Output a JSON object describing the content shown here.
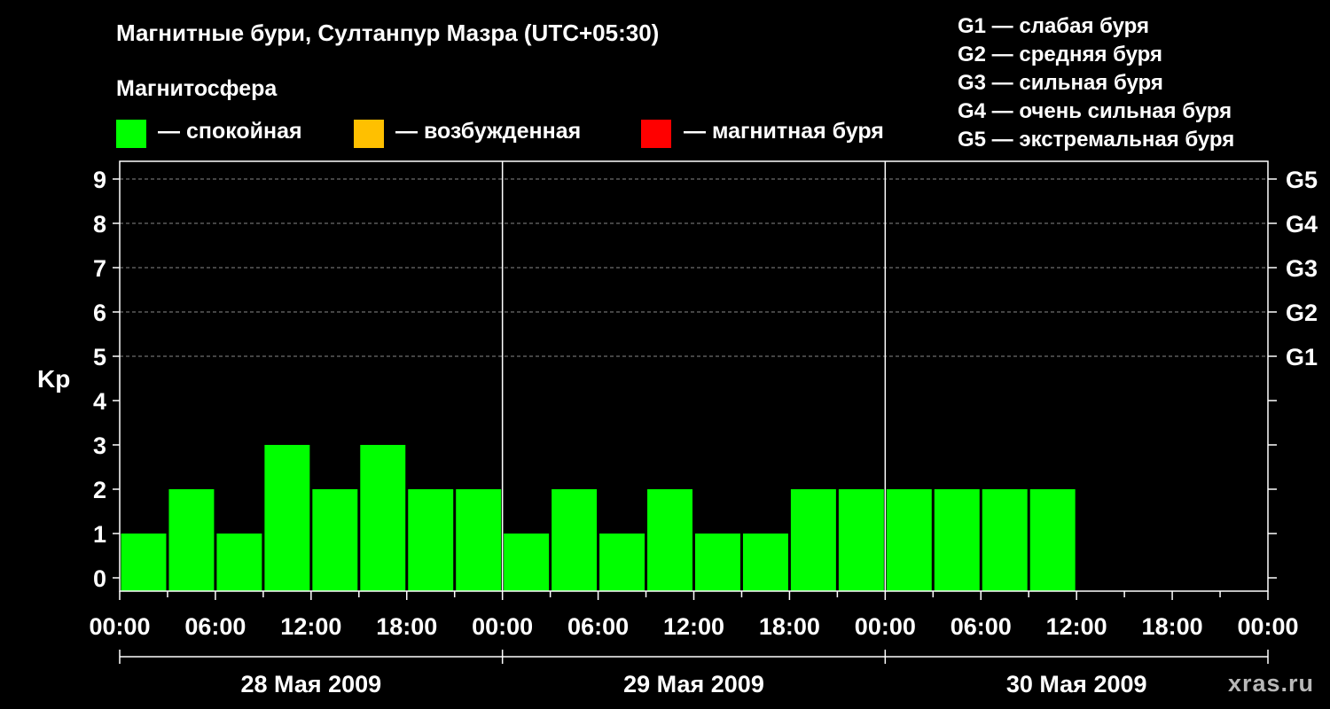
{
  "title": "Магнитные бури, Султанпур Мазра (UTC+05:30)",
  "magnetosphere": {
    "title": "Магнитосфера",
    "legend": [
      {
        "label": "— спокойная",
        "color": "#00ff00"
      },
      {
        "label": "— возбужденная",
        "color": "#ffc000"
      },
      {
        "label": "— магнитная буря",
        "color": "#ff0000"
      }
    ]
  },
  "g_legend": [
    "G1 — слабая буря",
    "G2 — средняя буря",
    "G3 — сильная буря",
    "G4 — очень сильная буря",
    "G5 — экстремальная буря"
  ],
  "watermark": "xras.ru",
  "chart_data": {
    "type": "bar",
    "ylabel": "Kp",
    "ylim": [
      0,
      9
    ],
    "y_ticks": [
      "0",
      "1",
      "2",
      "3",
      "4",
      "5",
      "6",
      "7",
      "8",
      "9"
    ],
    "right_ticks": [
      {
        "value": 5,
        "label": "G1"
      },
      {
        "value": 6,
        "label": "G2"
      },
      {
        "value": 7,
        "label": "G3"
      },
      {
        "value": 8,
        "label": "G4"
      },
      {
        "value": 9,
        "label": "G5"
      }
    ],
    "grid_levels": [
      5,
      6,
      7,
      8,
      9
    ],
    "x_tick_labels": [
      "00:00",
      "06:00",
      "12:00",
      "18:00",
      "00:00",
      "06:00",
      "12:00",
      "18:00",
      "00:00",
      "06:00",
      "12:00",
      "18:00",
      "00:00"
    ],
    "days": [
      "28 Мая 2009",
      "29 Мая 2009",
      "30 Мая 2009"
    ],
    "bar_interval_hours": 3,
    "values": [
      1,
      2,
      1,
      3,
      2,
      3,
      2,
      2,
      1,
      2,
      1,
      2,
      1,
      1,
      2,
      2,
      2,
      2,
      2,
      2
    ],
    "bar_color": "#00ff00"
  }
}
